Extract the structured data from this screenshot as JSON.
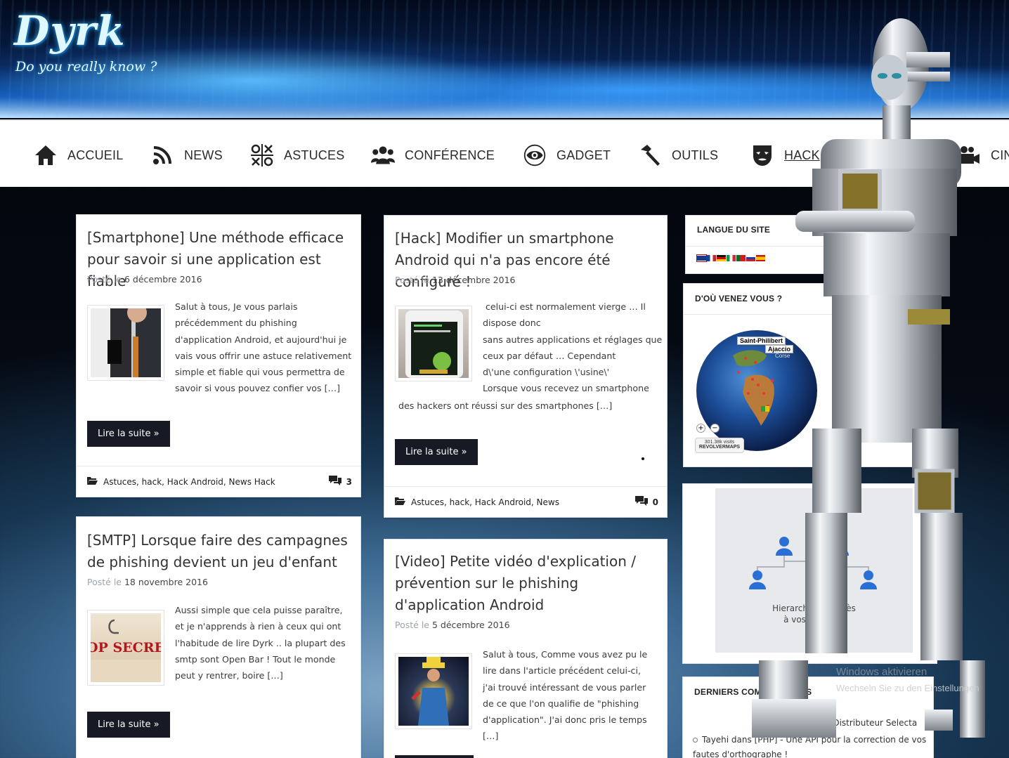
{
  "header": {
    "logo_text": "Dyrk",
    "tagline": "Do you really know ?"
  },
  "nav": {
    "items": [
      {
        "label": "ACCUEIL",
        "icon": "home-icon"
      },
      {
        "label": "NEWS",
        "icon": "rss-icon"
      },
      {
        "label": "ASTUCES",
        "icon": "tic-tac-toe-icon"
      },
      {
        "label": "CONFÉRENCE",
        "icon": "users-icon"
      },
      {
        "label": "GADGET",
        "icon": "eye-icon"
      },
      {
        "label": "OUTILS",
        "icon": "hammer-icon"
      },
      {
        "label": "HACK",
        "icon": "anonymous-mask-icon"
      },
      {
        "label": "CIN",
        "icon": "camera-icon"
      }
    ]
  },
  "posts": [
    {
      "title": "[Smartphone] Une méthode efficace pour savoir si une application est fiable",
      "posted_label": "Posté le",
      "date": "6 décembre 2016",
      "excerpt": " Salut à tous,   Je vous parlais précédemment du phishing d'application Android, et aujourd'hui je vais vous offrir une astuce relativement simple et fiable qui vous permettra de savoir si vous pouvez confier vos […]",
      "read_more": "Lire la suite »",
      "categories": "Astuces, hack, Hack Android, News Hack",
      "comments": "3"
    },
    {
      "title": "[Hack] Modifier un smartphone Android qui n'a pas encore été configuré !",
      "posted_label": "Posté le",
      "date": "13 décembre 2016",
      "excerpt_lines": [
        "celui-ci est  normalement vierge … Il",
        "dispose donc",
        " sans autres applications et réglages que",
        "ceux par défaut …   Cependant",
        " d\\'une configuration \\'usine\\'",
        "Lorsque vous recevez un smartphone",
        "des hackers ont réussi sur des smartphones […]"
      ],
      "read_more": "Lire la suite »",
      "categories": "Astuces, hack, Hack Android, News",
      "comments": "0"
    },
    {
      "title": "[SMTP] Lorsque faire des campagnes de phishing devient un jeu d'enfant",
      "posted_label": "Posté le",
      "date": "18 novembre 2016",
      "excerpt": " Aussi simple que cela puisse paraître, et je n'apprends à rien à ceux qui ont l'habitude de lire Dyrk .. la plupart des smtp sont Open Bar ! Tout le monde peut y rentrer, boire […]",
      "read_more": "Lire la suite »",
      "thumb_text": "OP SECRE"
    },
    {
      "title": "[Video] Petite vidéo d'explication / prévention sur le phishing d'application Android",
      "posted_label": "Posté le",
      "date": "5 décembre 2016",
      "excerpt": " Salut à tous,   Comme vous avez  pu le lire dans l'article précédent celui-ci, j'ai trouvé intéressant de vous parler de ce que l'on qualifie de \"phishing d'application\".   J'ai donc pris le temps […]"
    }
  ],
  "widgets": {
    "langue": {
      "title": "LANGUE DU SITE"
    },
    "visitors": {
      "title": "D'OÙ VENEZ VOUS ?",
      "map_label_1": "Saint-Philibert",
      "map_label_2": "Ajaccio",
      "map_label_3": "Corse",
      "zoom_in": "+",
      "zoom_out": "−",
      "visits": "301.38k visits",
      "brand": "REVOLVERMAPS"
    },
    "hierarchy": {
      "line1": "Hierarchisez l'accès",
      "line2": "à vos données"
    },
    "comments": {
      "title": "DERNIERS COMMENTAIRES",
      "item1": "C - Distributeur Selecta",
      "item2": "Tayehi dans [PHP] - Une API pour la correction de vos fautes d'orthographe !"
    }
  },
  "os_watermark": {
    "line1": "Windows aktivieren",
    "line2": "Wechseln Sie zu den Einstellungen"
  },
  "colors": {
    "nav_bg": "#ffffff",
    "button_bg": "#171a24",
    "card_bg": "#ffffff",
    "header_glow": "#2ab0ff"
  }
}
